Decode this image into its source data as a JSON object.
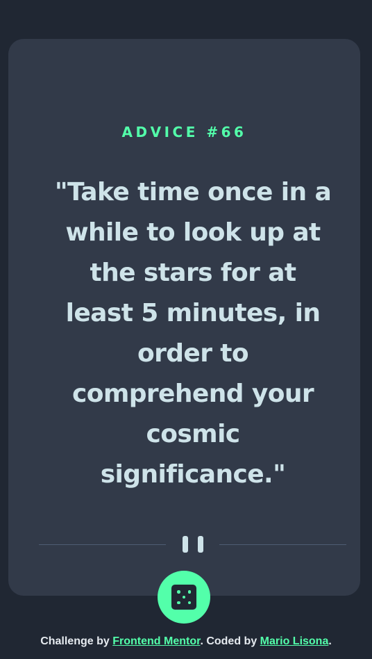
{
  "advice": {
    "label": "ADVICE #66",
    "quote": "\"Take time once in a while to look up at the stars for at least 5 minutes, in order to comprehend your cosmic significance.\""
  },
  "divider": {
    "icon": "pause-icon"
  },
  "dice_button": {
    "icon": "dice-icon"
  },
  "footer": {
    "prefix": "Challenge by ",
    "challenge_link": "Frontend Mentor",
    "middle": ". Coded by ",
    "author_link": "Mario Lisona",
    "suffix": "."
  },
  "colors": {
    "background": "#202733",
    "card": "#323a49",
    "accent": "#53ffaa",
    "text": "#cee3e9",
    "divider": "#4f5d74"
  }
}
